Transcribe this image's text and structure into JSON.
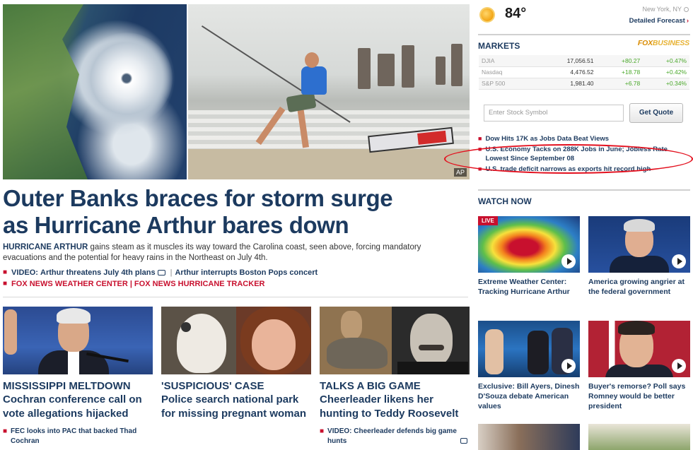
{
  "hero": {
    "credit": "AP"
  },
  "lead": {
    "headline_line1": "Outer Banks braces for storm surge",
    "headline_line2": "as Hurricane Arthur bares down",
    "summary_kicker": "HURRICANE ARTHUR",
    "summary_text": "gains steam as it muscles its way toward the Carolina coast, seen above, forcing mandatory evacuations and the potential for heavy rains in the Northeast on July 4th.",
    "video_prefix": "VIDEO:",
    "video_link1": "Arthur threatens July 4th plans",
    "video_link2": "Arthur interrupts Boston Pops concert",
    "red_link1": "FOX NEWS WEATHER CENTER",
    "red_link2": "FOX NEWS HURRICANE TRACKER",
    "separator": "|"
  },
  "stories": [
    {
      "kicker": "MISSISSIPPI MELTDOWN",
      "title": "Cochran conference call on vote allegations hijacked",
      "sub": "FEC looks into PAC that backed Thad Cochran"
    },
    {
      "kicker": "'SUSPICIOUS' CASE",
      "title": "Police search national park for missing pregnant woman",
      "sub": ""
    },
    {
      "kicker": "TALKS A BIG GAME",
      "title": "Cheerleader likens her hunting to Teddy Roosevelt",
      "sub": "VIDEO: Cheerleader defends big game hunts"
    }
  ],
  "weather": {
    "icon": "sun-icon",
    "temp": "84°",
    "location": "New York, NY",
    "forecast_link": "Detailed Forecast",
    "chevron": "›"
  },
  "markets": {
    "title": "MARKETS",
    "logo_fox": "FOX",
    "logo_business": "BUSINESS",
    "rows": [
      {
        "name": "DJIA",
        "value": "17,056.51",
        "change": "+80.27",
        "pct": "+0.47%"
      },
      {
        "name": "Nasdaq",
        "value": "4,476.52",
        "change": "+18.78",
        "pct": "+0.42%"
      },
      {
        "name": "S&P 500",
        "value": "1,981.40",
        "change": "+6.78",
        "pct": "+0.34%"
      }
    ],
    "input_placeholder": "Enter Stock Symbol",
    "quote_button": "Get Quote",
    "up_color": "#4aa82a"
  },
  "business_news": [
    "Dow Hits 17K as Jobs Data Beat Views",
    "U.S. Economy Tacks on 288K Jobs in June; Jobless Rate Lowest Since September 08",
    "U.S. trade deficit narrows as exports hit record high"
  ],
  "watch_now": {
    "title": "WATCH NOW",
    "live_label": "LIVE",
    "videos": [
      {
        "caption": "Extreme Weather Center: Tracking Hurricane Arthur"
      },
      {
        "caption": "America growing angrier at the federal government"
      },
      {
        "caption": "Exclusive: Bill Ayers, Dinesh D'Souza debate American values"
      },
      {
        "caption": "Buyer's remorse? Poll says Romney would be better president"
      }
    ]
  },
  "colors": {
    "navy": "#1c3a5f",
    "accent_red": "#c8102e",
    "highlight_circle": "#e3101e"
  }
}
